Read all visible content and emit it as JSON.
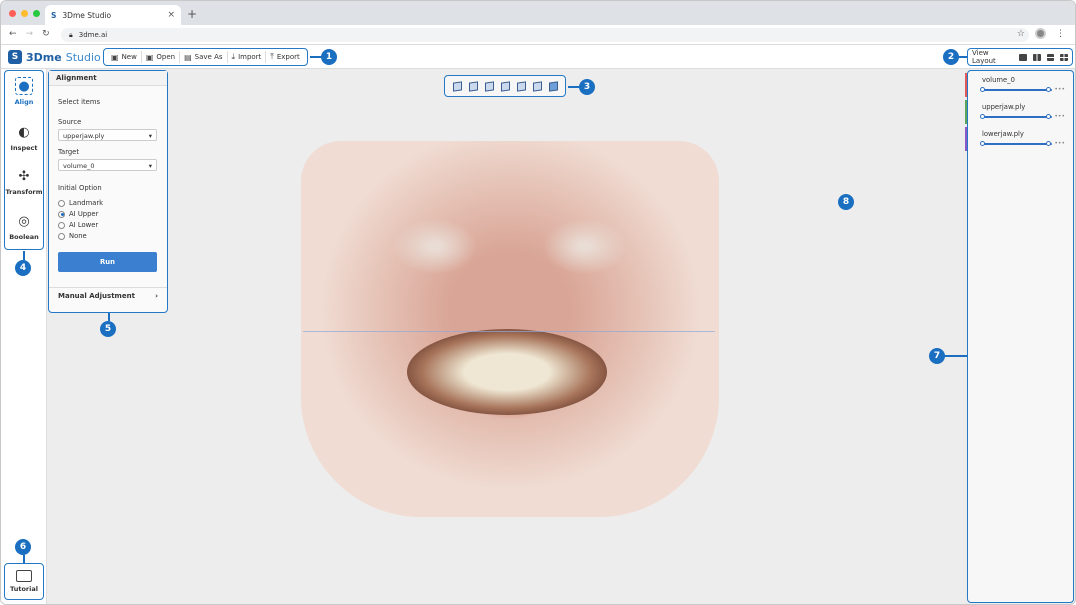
{
  "browser": {
    "tab_title": "3Dme Studio",
    "url": "3dme.ai"
  },
  "app": {
    "logo_bold": "3Dme",
    "logo_light": "Studio"
  },
  "file_toolbar": [
    {
      "label": "New",
      "icon": "document-icon"
    },
    {
      "label": "Open",
      "icon": "folder-icon"
    },
    {
      "label": "Save As",
      "icon": "save-icon"
    },
    {
      "label": "Import",
      "icon": "import-icon"
    },
    {
      "label": "Export",
      "icon": "export-icon"
    }
  ],
  "view_layout": {
    "label": "View Layout",
    "options": [
      "single",
      "two-columns",
      "three-panes",
      "four-panes"
    ]
  },
  "tools": [
    {
      "label": "Align",
      "icon": "align-head-icon",
      "active": true
    },
    {
      "label": "Inspect",
      "icon": "inspect-head-icon",
      "active": false
    },
    {
      "label": "Transform",
      "icon": "transform-gizmo-icon",
      "active": false
    },
    {
      "label": "Boolean",
      "icon": "boolean-circles-icon",
      "active": false
    }
  ],
  "tutorial": {
    "label": "Tutorial",
    "icon": "tutorial-screen-icon"
  },
  "alignment_panel": {
    "title": "Alignment",
    "select_items": "Select items",
    "source_label": "Source",
    "source_value": "upperjaw.ply",
    "target_label": "Target",
    "target_value": "volume_0",
    "initial_option_label": "Initial Option",
    "options": [
      "Landmark",
      "AI Upper",
      "AI Lower",
      "None"
    ],
    "selected_option": "AI Upper",
    "run_label": "Run",
    "manual_adjustment": "Manual Adjustment"
  },
  "objects": [
    {
      "name": "volume_0",
      "color": "#e05a5a"
    },
    {
      "name": "upperjaw.ply",
      "color": "#5aa55a"
    },
    {
      "name": "lowerjaw.ply",
      "color": "#8a5ac8"
    }
  ],
  "callouts": [
    "1",
    "2",
    "3",
    "4",
    "5",
    "6",
    "7",
    "8"
  ],
  "colors": {
    "accent": "#1a6fc1"
  }
}
